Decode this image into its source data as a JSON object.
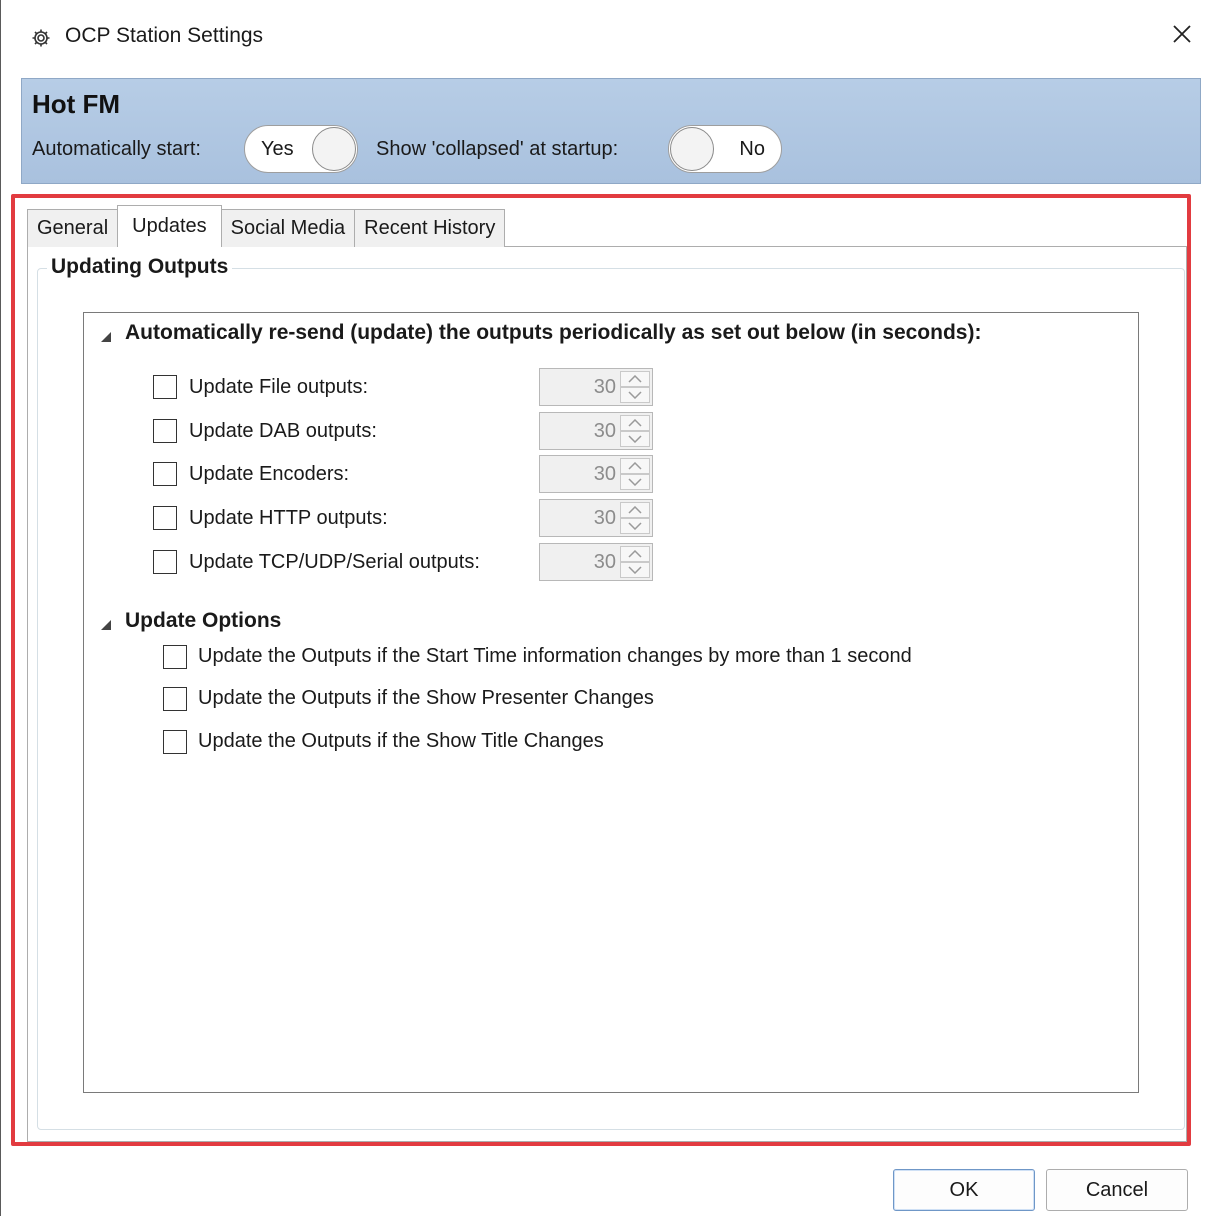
{
  "window": {
    "title": "OCP Station Settings",
    "title_icon": "gear-icon",
    "close_icon": "close-icon"
  },
  "station": {
    "name": "Hot FM",
    "auto_start_label": "Automatically start:",
    "auto_start_value": "Yes",
    "collapsed_label": "Show 'collapsed' at startup:",
    "collapsed_value": "No"
  },
  "tabs": [
    {
      "label": "General",
      "active": false
    },
    {
      "label": "Updates",
      "active": true
    },
    {
      "label": "Social Media",
      "active": false
    },
    {
      "label": "Recent History",
      "active": false
    }
  ],
  "updates": {
    "group_title": "Updating Outputs",
    "periodic_section": {
      "title": "Automatically re-send (update) the outputs periodically as set out below (in seconds):",
      "rows": [
        {
          "label": "Update File outputs:",
          "checked": false,
          "seconds": "30"
        },
        {
          "label": "Update DAB outputs:",
          "checked": false,
          "seconds": "30"
        },
        {
          "label": "Update Encoders:",
          "checked": false,
          "seconds": "30"
        },
        {
          "label": "Update HTTP outputs:",
          "checked": false,
          "seconds": "30"
        },
        {
          "label": "Update TCP/UDP/Serial outputs:",
          "checked": false,
          "seconds": "30"
        }
      ]
    },
    "options_section": {
      "title": "Update Options",
      "options": [
        {
          "label": "Update the Outputs if the Start Time information changes by more than 1 second",
          "checked": false
        },
        {
          "label": "Update the Outputs if the Show Presenter Changes",
          "checked": false
        },
        {
          "label": "Update the Outputs if the Show Title Changes",
          "checked": false
        }
      ]
    }
  },
  "footer": {
    "ok_label": "OK",
    "cancel_label": "Cancel"
  },
  "colors": {
    "header_bg": "#b2c9e3",
    "highlight_border": "#e23b40"
  }
}
